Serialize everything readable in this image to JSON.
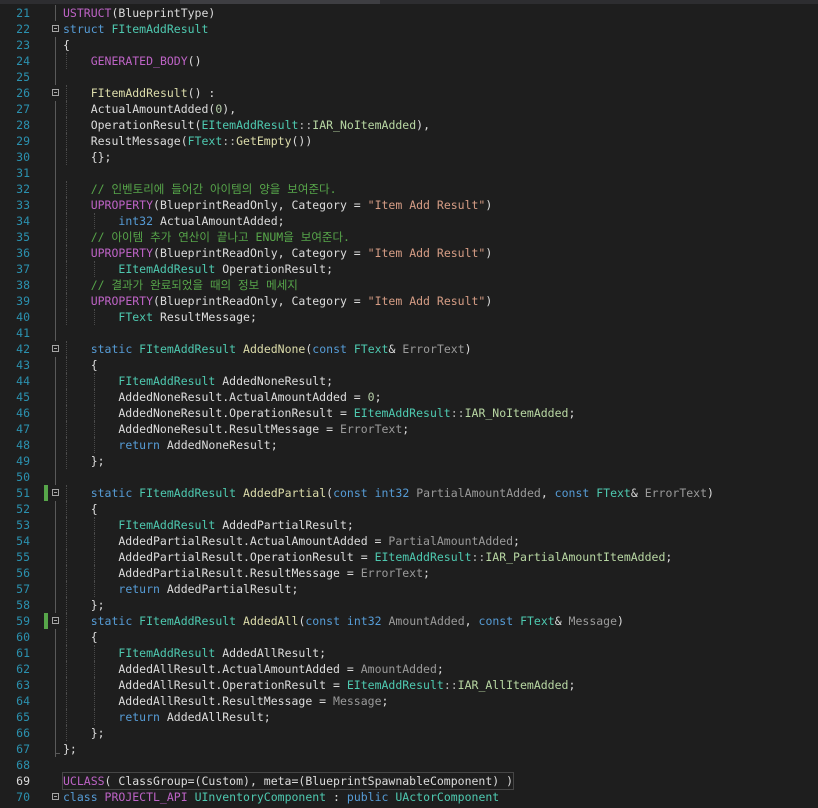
{
  "editor": {
    "language": "cpp",
    "lines": [
      {
        "n": "21",
        "tokens": [
          {
            "t": "USTRUCT",
            "c": "mac"
          },
          {
            "t": "(BlueprintType)",
            "c": "tx"
          }
        ]
      },
      {
        "n": "22",
        "fold": true,
        "tokens": [
          {
            "t": "struct ",
            "c": "kw"
          },
          {
            "t": "FItemAddResult",
            "c": "ty"
          }
        ]
      },
      {
        "n": "23",
        "tokens": [
          {
            "t": "{",
            "c": "tx"
          }
        ]
      },
      {
        "n": "24",
        "tokens": [
          {
            "t": "    ",
            "c": "tx"
          },
          {
            "t": "GENERATED_BODY",
            "c": "mac"
          },
          {
            "t": "()",
            "c": "tx"
          }
        ]
      },
      {
        "n": "25",
        "tokens": []
      },
      {
        "n": "26",
        "fold": true,
        "tokens": [
          {
            "t": "    ",
            "c": "tx"
          },
          {
            "t": "FItemAddResult",
            "c": "fn"
          },
          {
            "t": "() :",
            "c": "tx"
          }
        ]
      },
      {
        "n": "27",
        "tokens": [
          {
            "t": "    ActualAmountAdded(",
            "c": "tx"
          },
          {
            "t": "0",
            "c": "num"
          },
          {
            "t": "),",
            "c": "tx"
          }
        ]
      },
      {
        "n": "28",
        "tokens": [
          {
            "t": "    OperationResult(",
            "c": "tx"
          },
          {
            "t": "EItemAddResult",
            "c": "ty"
          },
          {
            "t": "::",
            "c": "op"
          },
          {
            "t": "IAR_NoItemAdded",
            "c": "en"
          },
          {
            "t": "),",
            "c": "tx"
          }
        ]
      },
      {
        "n": "29",
        "tokens": [
          {
            "t": "    ResultMessage(",
            "c": "tx"
          },
          {
            "t": "FText",
            "c": "ty"
          },
          {
            "t": "::",
            "c": "op"
          },
          {
            "t": "GetEmpty",
            "c": "fn"
          },
          {
            "t": "())",
            "c": "tx"
          }
        ]
      },
      {
        "n": "30",
        "tokens": [
          {
            "t": "    {};",
            "c": "tx"
          }
        ]
      },
      {
        "n": "31",
        "tokens": []
      },
      {
        "n": "32",
        "tokens": [
          {
            "t": "    // 인벤토리에 들어간 아이템의 양을 보여준다.",
            "c": "com"
          }
        ]
      },
      {
        "n": "33",
        "tokens": [
          {
            "t": "    ",
            "c": "tx"
          },
          {
            "t": "UPROPERTY",
            "c": "mac"
          },
          {
            "t": "(BlueprintReadOnly, Category = ",
            "c": "tx"
          },
          {
            "t": "\"Item Add Result\"",
            "c": "str"
          },
          {
            "t": ")",
            "c": "tx"
          }
        ]
      },
      {
        "n": "34",
        "tokens": [
          {
            "t": "        ",
            "c": "tx"
          },
          {
            "t": "int32",
            "c": "kw"
          },
          {
            "t": " ActualAmountAdded;",
            "c": "tx"
          }
        ]
      },
      {
        "n": "35",
        "tokens": [
          {
            "t": "    // 아이템 추가 연산이 끝나고 ENUM을 보여준다.",
            "c": "com"
          }
        ]
      },
      {
        "n": "36",
        "tokens": [
          {
            "t": "    ",
            "c": "tx"
          },
          {
            "t": "UPROPERTY",
            "c": "mac"
          },
          {
            "t": "(BlueprintReadOnly, Category = ",
            "c": "tx"
          },
          {
            "t": "\"Item Add Result\"",
            "c": "str"
          },
          {
            "t": ")",
            "c": "tx"
          }
        ]
      },
      {
        "n": "37",
        "tokens": [
          {
            "t": "        ",
            "c": "tx"
          },
          {
            "t": "EItemAddResult",
            "c": "ty"
          },
          {
            "t": " OperationResult;",
            "c": "tx"
          }
        ]
      },
      {
        "n": "38",
        "tokens": [
          {
            "t": "    // 결과가 완료되었을 때의 정보 메세지",
            "c": "com"
          }
        ]
      },
      {
        "n": "39",
        "tokens": [
          {
            "t": "    ",
            "c": "tx"
          },
          {
            "t": "UPROPERTY",
            "c": "mac"
          },
          {
            "t": "(BlueprintReadOnly, Category = ",
            "c": "tx"
          },
          {
            "t": "\"Item Add Result\"",
            "c": "str"
          },
          {
            "t": ")",
            "c": "tx"
          }
        ]
      },
      {
        "n": "40",
        "tokens": [
          {
            "t": "        ",
            "c": "tx"
          },
          {
            "t": "FText",
            "c": "ty"
          },
          {
            "t": " ResultMessage;",
            "c": "tx"
          }
        ]
      },
      {
        "n": "41",
        "tokens": []
      },
      {
        "n": "42",
        "fold": true,
        "tokens": [
          {
            "t": "    ",
            "c": "tx"
          },
          {
            "t": "static ",
            "c": "kw"
          },
          {
            "t": "FItemAddResult",
            "c": "ty"
          },
          {
            "t": " ",
            "c": "tx"
          },
          {
            "t": "AddedNone",
            "c": "fn"
          },
          {
            "t": "(",
            "c": "tx"
          },
          {
            "t": "const ",
            "c": "kw"
          },
          {
            "t": "FText",
            "c": "ty"
          },
          {
            "t": "& ",
            "c": "tx"
          },
          {
            "t": "ErrorText",
            "c": "par"
          },
          {
            "t": ")",
            "c": "tx"
          }
        ]
      },
      {
        "n": "43",
        "tokens": [
          {
            "t": "    {",
            "c": "tx"
          }
        ]
      },
      {
        "n": "44",
        "tokens": [
          {
            "t": "        ",
            "c": "tx"
          },
          {
            "t": "FItemAddResult",
            "c": "ty"
          },
          {
            "t": " AddedNoneResult;",
            "c": "tx"
          }
        ]
      },
      {
        "n": "45",
        "tokens": [
          {
            "t": "        AddedNoneResult.ActualAmountAdded = ",
            "c": "tx"
          },
          {
            "t": "0",
            "c": "num"
          },
          {
            "t": ";",
            "c": "tx"
          }
        ]
      },
      {
        "n": "46",
        "tokens": [
          {
            "t": "        AddedNoneResult.OperationResult = ",
            "c": "tx"
          },
          {
            "t": "EItemAddResult",
            "c": "ty"
          },
          {
            "t": "::",
            "c": "op"
          },
          {
            "t": "IAR_NoItemAdded",
            "c": "en"
          },
          {
            "t": ";",
            "c": "tx"
          }
        ]
      },
      {
        "n": "47",
        "tokens": [
          {
            "t": "        AddedNoneResult.ResultMessage = ",
            "c": "tx"
          },
          {
            "t": "ErrorText",
            "c": "par"
          },
          {
            "t": ";",
            "c": "tx"
          }
        ]
      },
      {
        "n": "48",
        "tokens": [
          {
            "t": "        ",
            "c": "tx"
          },
          {
            "t": "return",
            "c": "kw"
          },
          {
            "t": " AddedNoneResult;",
            "c": "tx"
          }
        ]
      },
      {
        "n": "49",
        "tokens": [
          {
            "t": "    };",
            "c": "tx"
          }
        ]
      },
      {
        "n": "50",
        "tokens": []
      },
      {
        "n": "51",
        "fold": true,
        "changed": true,
        "tokens": [
          {
            "t": "    ",
            "c": "tx"
          },
          {
            "t": "static ",
            "c": "kw"
          },
          {
            "t": "FItemAddResult",
            "c": "ty"
          },
          {
            "t": " ",
            "c": "tx"
          },
          {
            "t": "AddedPartial",
            "c": "fn"
          },
          {
            "t": "(",
            "c": "tx"
          },
          {
            "t": "const ",
            "c": "kw"
          },
          {
            "t": "int32",
            "c": "kw"
          },
          {
            "t": " ",
            "c": "tx"
          },
          {
            "t": "PartialAmountAdded",
            "c": "par"
          },
          {
            "t": ", ",
            "c": "tx"
          },
          {
            "t": "const ",
            "c": "kw"
          },
          {
            "t": "FText",
            "c": "ty"
          },
          {
            "t": "& ",
            "c": "tx"
          },
          {
            "t": "ErrorText",
            "c": "par"
          },
          {
            "t": ")",
            "c": "tx"
          }
        ]
      },
      {
        "n": "52",
        "tokens": [
          {
            "t": "    {",
            "c": "tx"
          }
        ]
      },
      {
        "n": "53",
        "tokens": [
          {
            "t": "        ",
            "c": "tx"
          },
          {
            "t": "FItemAddResult",
            "c": "ty"
          },
          {
            "t": " AddedPartialResult;",
            "c": "tx"
          }
        ]
      },
      {
        "n": "54",
        "tokens": [
          {
            "t": "        AddedPartialResult.ActualAmountAdded = ",
            "c": "tx"
          },
          {
            "t": "PartialAmountAdded",
            "c": "par"
          },
          {
            "t": ";",
            "c": "tx"
          }
        ]
      },
      {
        "n": "55",
        "tokens": [
          {
            "t": "        AddedPartialResult.OperationResult = ",
            "c": "tx"
          },
          {
            "t": "EItemAddResult",
            "c": "ty"
          },
          {
            "t": "::",
            "c": "op"
          },
          {
            "t": "IAR_PartialAmountItemAdded",
            "c": "en"
          },
          {
            "t": ";",
            "c": "tx"
          }
        ]
      },
      {
        "n": "56",
        "tokens": [
          {
            "t": "        AddedPartialResult.ResultMessage = ",
            "c": "tx"
          },
          {
            "t": "ErrorText",
            "c": "par"
          },
          {
            "t": ";",
            "c": "tx"
          }
        ]
      },
      {
        "n": "57",
        "tokens": [
          {
            "t": "        ",
            "c": "tx"
          },
          {
            "t": "return",
            "c": "kw"
          },
          {
            "t": " AddedPartialResult;",
            "c": "tx"
          }
        ]
      },
      {
        "n": "58",
        "tokens": [
          {
            "t": "    };",
            "c": "tx"
          }
        ]
      },
      {
        "n": "59",
        "fold": true,
        "changed": true,
        "tokens": [
          {
            "t": "    ",
            "c": "tx"
          },
          {
            "t": "static ",
            "c": "kw"
          },
          {
            "t": "FItemAddResult",
            "c": "ty"
          },
          {
            "t": " ",
            "c": "tx"
          },
          {
            "t": "AddedAll",
            "c": "fn"
          },
          {
            "t": "(",
            "c": "tx"
          },
          {
            "t": "const ",
            "c": "kw"
          },
          {
            "t": "int32",
            "c": "kw"
          },
          {
            "t": " ",
            "c": "tx"
          },
          {
            "t": "AmountAdded",
            "c": "par"
          },
          {
            "t": ", ",
            "c": "tx"
          },
          {
            "t": "const ",
            "c": "kw"
          },
          {
            "t": "FText",
            "c": "ty"
          },
          {
            "t": "& ",
            "c": "tx"
          },
          {
            "t": "Message",
            "c": "par"
          },
          {
            "t": ")",
            "c": "tx"
          }
        ]
      },
      {
        "n": "60",
        "tokens": [
          {
            "t": "    {",
            "c": "tx"
          }
        ]
      },
      {
        "n": "61",
        "tokens": [
          {
            "t": "        ",
            "c": "tx"
          },
          {
            "t": "FItemAddResult",
            "c": "ty"
          },
          {
            "t": " AddedAllResult;",
            "c": "tx"
          }
        ]
      },
      {
        "n": "62",
        "tokens": [
          {
            "t": "        AddedAllResult.ActualAmountAdded = ",
            "c": "tx"
          },
          {
            "t": "AmountAdded",
            "c": "par"
          },
          {
            "t": ";",
            "c": "tx"
          }
        ]
      },
      {
        "n": "63",
        "tokens": [
          {
            "t": "        AddedAllResult.OperationResult = ",
            "c": "tx"
          },
          {
            "t": "EItemAddResult",
            "c": "ty"
          },
          {
            "t": "::",
            "c": "op"
          },
          {
            "t": "IAR_AllItemAdded",
            "c": "en"
          },
          {
            "t": ";",
            "c": "tx"
          }
        ]
      },
      {
        "n": "64",
        "tokens": [
          {
            "t": "        AddedAllResult.ResultMessage = ",
            "c": "tx"
          },
          {
            "t": "Message",
            "c": "par"
          },
          {
            "t": ";",
            "c": "tx"
          }
        ]
      },
      {
        "n": "65",
        "tokens": [
          {
            "t": "        ",
            "c": "tx"
          },
          {
            "t": "return",
            "c": "kw"
          },
          {
            "t": " AddedAllResult;",
            "c": "tx"
          }
        ]
      },
      {
        "n": "66",
        "tokens": [
          {
            "t": "    };",
            "c": "tx"
          }
        ]
      },
      {
        "n": "67",
        "guideEnd": true,
        "tokens": [
          {
            "t": "};",
            "c": "tx"
          }
        ]
      },
      {
        "n": "68",
        "noGuide": true,
        "tokens": []
      },
      {
        "n": "69",
        "current": true,
        "noGuide": true,
        "tokens": [
          {
            "t": "UCLASS",
            "c": "mac"
          },
          {
            "t": "( ClassGroup=(Custom), meta=(BlueprintSpawnableComponent) )",
            "c": "tx"
          }
        ]
      },
      {
        "n": "70",
        "fold": true,
        "tokens": [
          {
            "t": "class ",
            "c": "kw"
          },
          {
            "t": "PROJECTL_API ",
            "c": "mac"
          },
          {
            "t": "UInventoryComponent",
            "c": "ty"
          },
          {
            "t": " : ",
            "c": "tx"
          },
          {
            "t": "public ",
            "c": "kw"
          },
          {
            "t": "UActorComponent",
            "c": "ty"
          }
        ]
      }
    ]
  }
}
